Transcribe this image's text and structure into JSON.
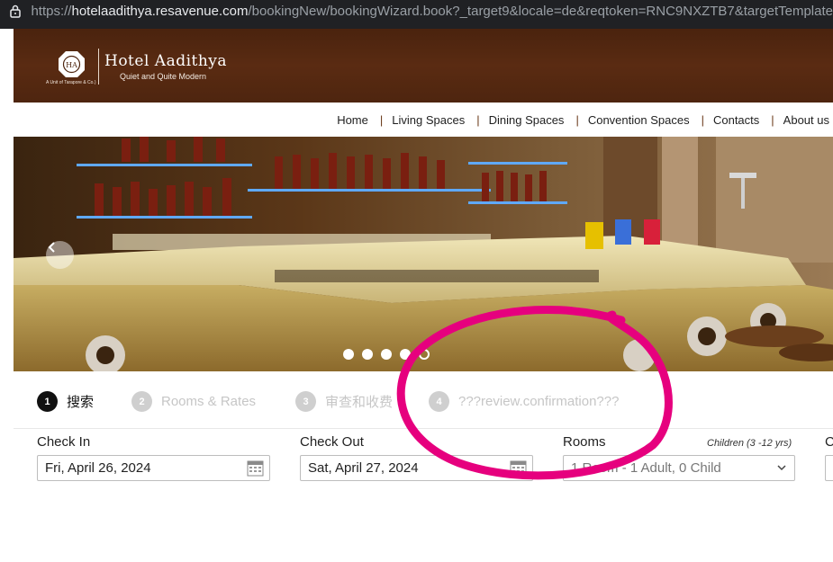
{
  "browser": {
    "url_proto": "https://",
    "url_host": "hotelaadithya.resavenue.com",
    "url_path": "/bookingNew/bookingWizard.book?_target9&locale=de&reqtoken=RNC9NXZTB7&targetTemplate"
  },
  "header": {
    "hotel_name": "Hotel Aadithya",
    "tagline": "Quiet and Quite Modern",
    "logo_sub": "A Unit of Tarapore & Co.)",
    "logo_initials": "HA",
    "brand_color": "#4e250f"
  },
  "nav": {
    "items": [
      "Home",
      "Living Spaces",
      "Dining Spaces",
      "Convention Spaces",
      "Contacts",
      "About us"
    ],
    "separator": "|"
  },
  "slider": {
    "prev_icon": "chevron-left-icon",
    "dots_count": 5,
    "active_dot": 5
  },
  "steps": [
    {
      "num": "1",
      "label": "搜索",
      "active": true
    },
    {
      "num": "2",
      "label": "Rooms & Rates",
      "active": false
    },
    {
      "num": "3",
      "label": "审查和收费",
      "active": false
    },
    {
      "num": "4",
      "label": "???review.confirmation???",
      "active": false
    }
  ],
  "form": {
    "checkin_label": "Check In",
    "checkin_value": "Fri, April 26, 2024",
    "checkout_label": "Check Out",
    "checkout_value": "Sat, April 27, 2024",
    "rooms_label": "Rooms",
    "children_label": "Children (3 -12 yrs)",
    "rooms_value": "1 Room - 1 Adult, 0 Child",
    "next_label_partial": "C",
    "calendar_icon": "calendar-icon",
    "dropdown_icon": "chevron-down-icon"
  },
  "annotation": {
    "color": "#e6007e"
  }
}
